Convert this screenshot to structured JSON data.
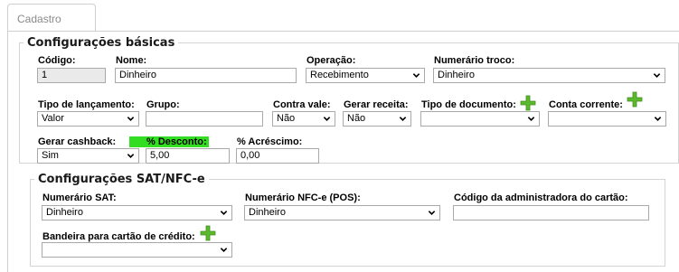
{
  "tab": {
    "label": "Cadastro"
  },
  "basic": {
    "legend": "Configurações básicas",
    "codigo": {
      "label": "Código:",
      "value": "1"
    },
    "nome": {
      "label": "Nome:",
      "value": "Dinheiro"
    },
    "operacao": {
      "label": "Operação:",
      "value": "Recebimento"
    },
    "numerario_troco": {
      "label": "Numerário troco:",
      "value": "Dinheiro"
    },
    "tipo_lancamento": {
      "label": "Tipo de lançamento:",
      "value": "Valor"
    },
    "grupo": {
      "label": "Grupo:",
      "value": ""
    },
    "contra_vale": {
      "label": "Contra vale:",
      "value": "Não"
    },
    "gerar_receita": {
      "label": "Gerar receita:",
      "value": "Não"
    },
    "tipo_documento": {
      "label": "Tipo de documento:",
      "value": ""
    },
    "conta_corrente": {
      "label": "Conta corrente:",
      "value": ""
    },
    "gerar_cashback": {
      "label": "Gerar cashback:",
      "value": "Sim"
    },
    "desconto": {
      "label": "% Desconto:",
      "value": "5,00",
      "highlight_color": "#33dd22"
    },
    "acrescimo": {
      "label": "% Acréscimo:",
      "value": "0,00"
    }
  },
  "sat": {
    "legend": "Configurações SAT/NFC-e",
    "numerario_sat": {
      "label": "Numerário SAT:",
      "value": "Dinheiro"
    },
    "numerario_nfce": {
      "label": "Numerário NFC-e (POS):",
      "value": "Dinheiro"
    },
    "codigo_admin": {
      "label": "Código da administradora do cartão:",
      "value": ""
    },
    "bandeira": {
      "label": "Bandeira para cartão de crédito:",
      "value": ""
    }
  },
  "icons": {
    "add": "plus-icon",
    "dropdown": "chevron-down-icon",
    "add_color": "#5cb82e"
  }
}
